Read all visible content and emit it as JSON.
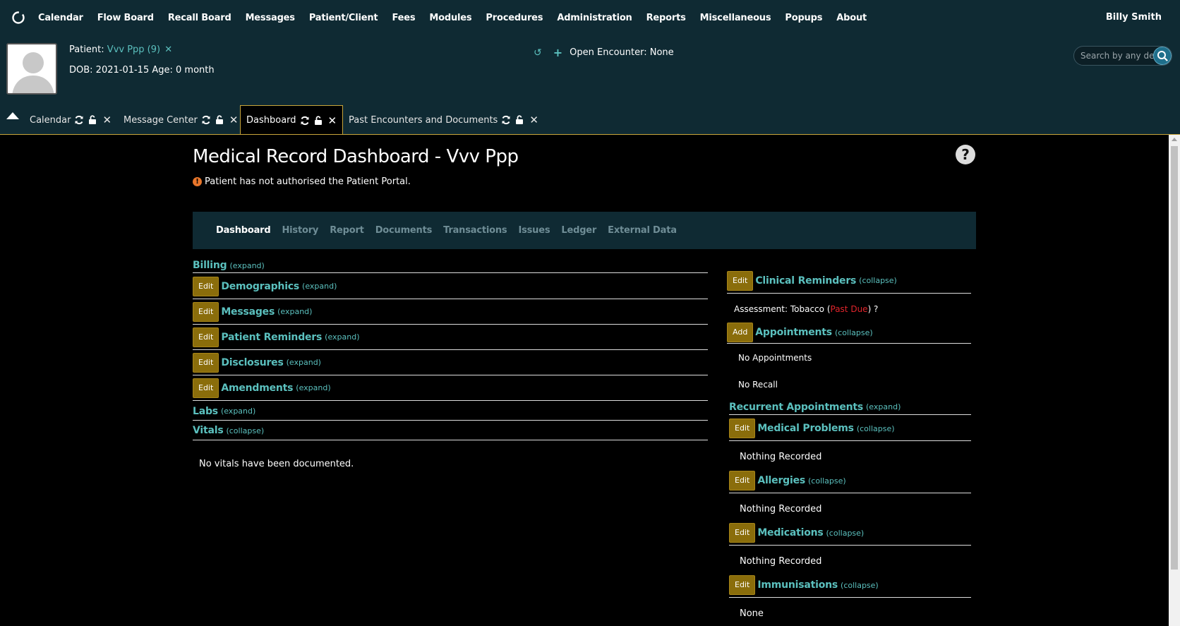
{
  "topnav": {
    "menu": [
      "Calendar",
      "Flow Board",
      "Recall Board",
      "Messages",
      "Patient/Client",
      "Fees",
      "Modules",
      "Procedures",
      "Administration",
      "Reports",
      "Miscellaneous",
      "Popups",
      "About"
    ],
    "user": "Billy Smith"
  },
  "patient": {
    "label": "Patient:",
    "name": "Vvv Ppp (9)",
    "close_glyph": "✕",
    "dob_line": "DOB: 2021-01-15 Age: 0 month"
  },
  "encounter": {
    "history_glyph": "↺",
    "add_glyph": "+",
    "label": "Open Encounter: None"
  },
  "search": {
    "placeholder": "Search by any demographics"
  },
  "tabs": [
    {
      "label": "Calendar"
    },
    {
      "label": "Message Center"
    },
    {
      "label": "Dashboard"
    },
    {
      "label": "Past Encounters and Documents"
    }
  ],
  "page": {
    "title": "Medical Record Dashboard - Vvv Ppp",
    "help_glyph": "?",
    "warn_glyph": "!",
    "portal_warning": "Patient has not authorised the Patient Portal."
  },
  "subnav": [
    "Dashboard",
    "History",
    "Report",
    "Documents",
    "Transactions",
    "Issues",
    "Ledger",
    "External Data"
  ],
  "left_sections": {
    "billing": {
      "title": "Billing",
      "toggle": "(expand)"
    },
    "demographics": {
      "button": "Edit",
      "title": "Demographics",
      "toggle": "(expand)"
    },
    "messages": {
      "button": "Edit",
      "title": "Messages",
      "toggle": "(expand)"
    },
    "patient_reminders": {
      "button": "Edit",
      "title": "Patient Reminders",
      "toggle": "(expand)"
    },
    "disclosures": {
      "button": "Edit",
      "title": "Disclosures",
      "toggle": "(expand)"
    },
    "amendments": {
      "button": "Edit",
      "title": "Amendments",
      "toggle": "(expand)"
    },
    "labs": {
      "title": "Labs",
      "toggle": "(expand)"
    },
    "vitals": {
      "title": "Vitals",
      "toggle": "(collapse)",
      "note": "No vitals have been documented."
    }
  },
  "right_sections": {
    "clinical_reminders": {
      "button": "Edit",
      "title": "Clinical Reminders",
      "toggle": "(collapse)",
      "assessment": "Assessment: Tobacco",
      "open_paren": "(",
      "past_due": "Past Due",
      "close": ") ?"
    },
    "appointments": {
      "button": "Add",
      "title": "Appointments",
      "toggle": "(collapse)",
      "note1": "No Appointments",
      "note2": "No Recall"
    },
    "recurrent": {
      "title": "Recurrent Appointments",
      "toggle": "(expand)"
    },
    "medical_problems": {
      "button": "Edit",
      "title": "Medical Problems",
      "toggle": "(collapse)",
      "note": "Nothing Recorded"
    },
    "allergies": {
      "button": "Edit",
      "title": "Allergies",
      "toggle": "(collapse)",
      "note": "Nothing Recorded"
    },
    "medications": {
      "button": "Edit",
      "title": "Medications",
      "toggle": "(collapse)",
      "note": "Nothing Recorded"
    },
    "immunisations": {
      "button": "Edit",
      "title": "Immunisations",
      "toggle": "(collapse)",
      "note": "None"
    }
  },
  "colors": {
    "nav_bg": "#0f2a33",
    "link": "#5bc0be",
    "button": "#8a6d0b",
    "active_tab_border": "#c8a53a",
    "past_due": "#e0242b"
  }
}
